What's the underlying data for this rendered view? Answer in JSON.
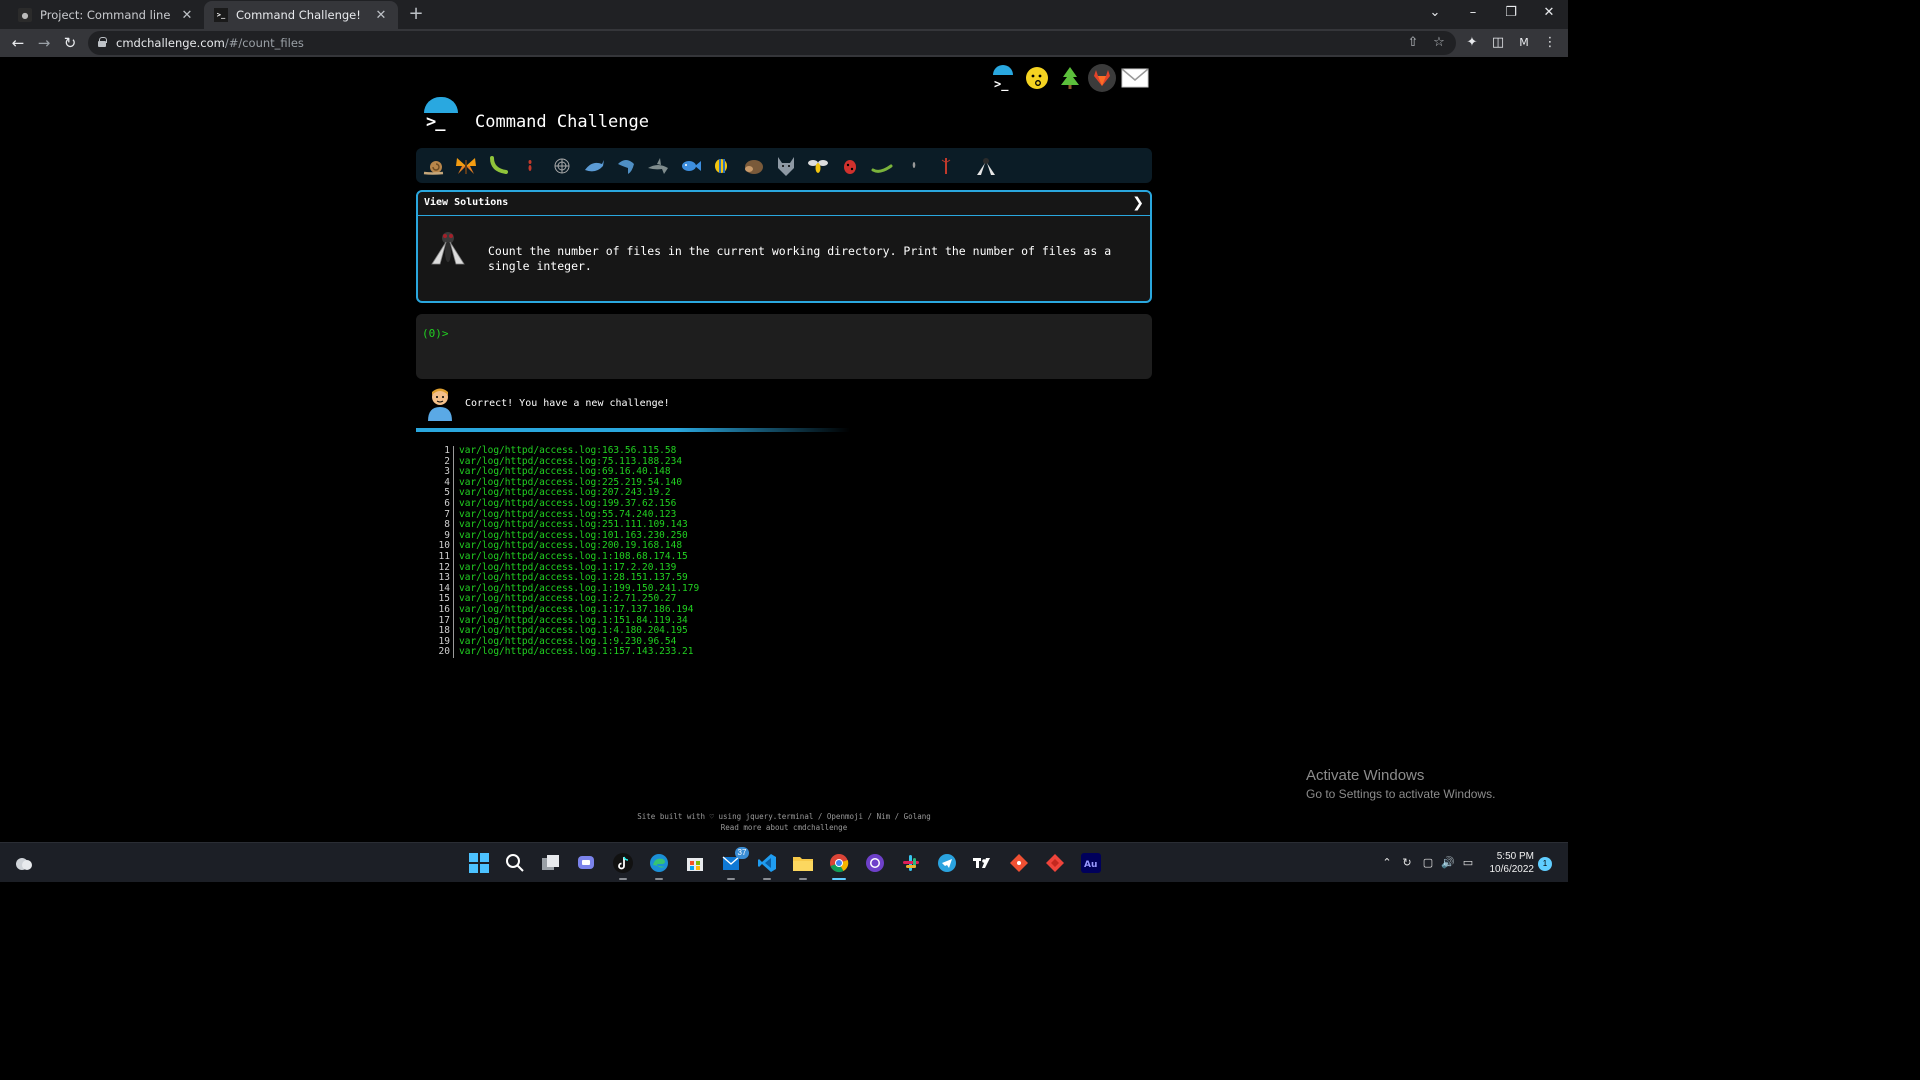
{
  "browser": {
    "tabs": [
      {
        "title": "Project: Command line for the wi",
        "active": false
      },
      {
        "title": "Command Challenge!",
        "active": true
      }
    ],
    "url_domain": "cmdchallenge.com",
    "url_path": "/#/count_files",
    "profile_initial": "M"
  },
  "site": {
    "title": "Command Challenge",
    "social_icons": [
      "terminal-logo-icon",
      "whistle-emoji-icon",
      "tree-icon",
      "gitlab-icon",
      "mail-icon"
    ],
    "bug_icons": [
      "snail-icon",
      "butterfly-icon",
      "caterpillar-icon",
      "ant-icon",
      "spider-web-icon",
      "whale-icon",
      "dolphin-icon",
      "shark-icon",
      "fish-icon",
      "tropical-fish-icon",
      "hedgehog-icon",
      "wolf-icon",
      "bee-icon",
      "ladybug-icon",
      "worm-icon",
      "mosquito-icon",
      "beetle-icon",
      "fly-icon"
    ],
    "challenge": {
      "header": "View Solutions",
      "description": "Count the number of files in the current working directory. Print the number of files as a single integer."
    },
    "terminal": {
      "prompt": "(0)>"
    },
    "feedback": {
      "message": "Correct! You have a new challenge!"
    },
    "output_lines": [
      "var/log/httpd/access.log:163.56.115.58",
      "var/log/httpd/access.log:75.113.188.234",
      "var/log/httpd/access.log:69.16.40.148",
      "var/log/httpd/access.log:225.219.54.140",
      "var/log/httpd/access.log:207.243.19.2",
      "var/log/httpd/access.log:199.37.62.156",
      "var/log/httpd/access.log:55.74.240.123",
      "var/log/httpd/access.log:251.111.109.143",
      "var/log/httpd/access.log:101.163.230.250",
      "var/log/httpd/access.log:200.19.168.148",
      "var/log/httpd/access.log.1:108.68.174.15",
      "var/log/httpd/access.log.1:17.2.20.139",
      "var/log/httpd/access.log.1:28.151.137.59",
      "var/log/httpd/access.log.1:199.150.241.179",
      "var/log/httpd/access.log.1:2.71.250.27",
      "var/log/httpd/access.log.1:17.137.186.194",
      "var/log/httpd/access.log.1:151.84.119.34",
      "var/log/httpd/access.log.1:4.180.204.195",
      "var/log/httpd/access.log.1:9.230.96.54",
      "var/log/httpd/access.log.1:157.143.233.21"
    ],
    "progress": 0.59,
    "footer_line1": "Site built with ♡ using jquery.terminal / Openmoji / Nim / Golang",
    "footer_line2": "Read more about cmdchallenge"
  },
  "windows": {
    "activate_title": "Activate Windows",
    "activate_subtitle": "Go to Settings to activate Windows.",
    "clock_time": "5:50 PM",
    "clock_date": "10/6/2022",
    "notification_count": "1",
    "teams_badge": "37"
  },
  "colors": {
    "accent": "#2aa7de",
    "terminal_green": "#21d021",
    "background": "#000000"
  }
}
